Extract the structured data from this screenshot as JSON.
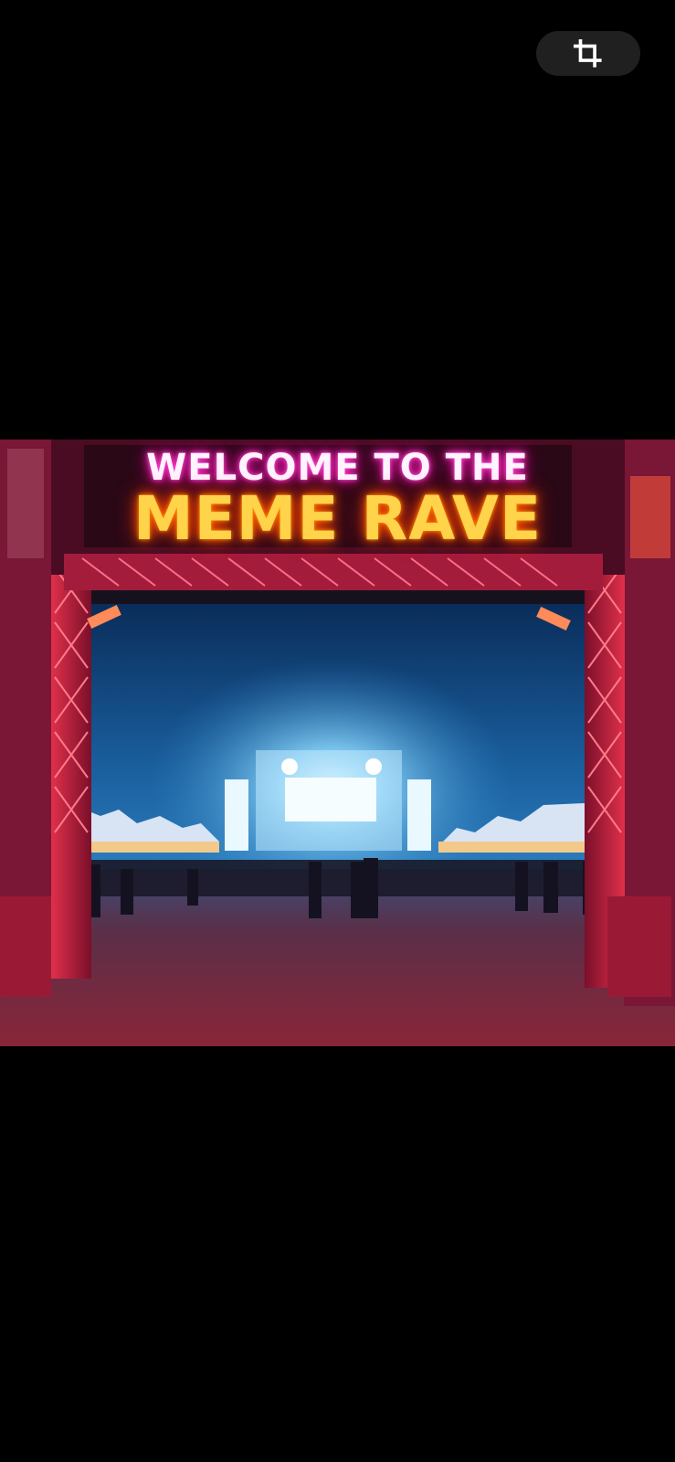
{
  "toolbar": {
    "crop_icon": "crop-icon"
  },
  "photo": {
    "sign": {
      "line1": "WELCOME TO THE",
      "line2": "MEME RAVE"
    },
    "colors": {
      "frame": "#9a1432",
      "sky": "#0d3f78",
      "stage_glow": "#aee7ff",
      "ground": "#4a1f2f"
    }
  }
}
